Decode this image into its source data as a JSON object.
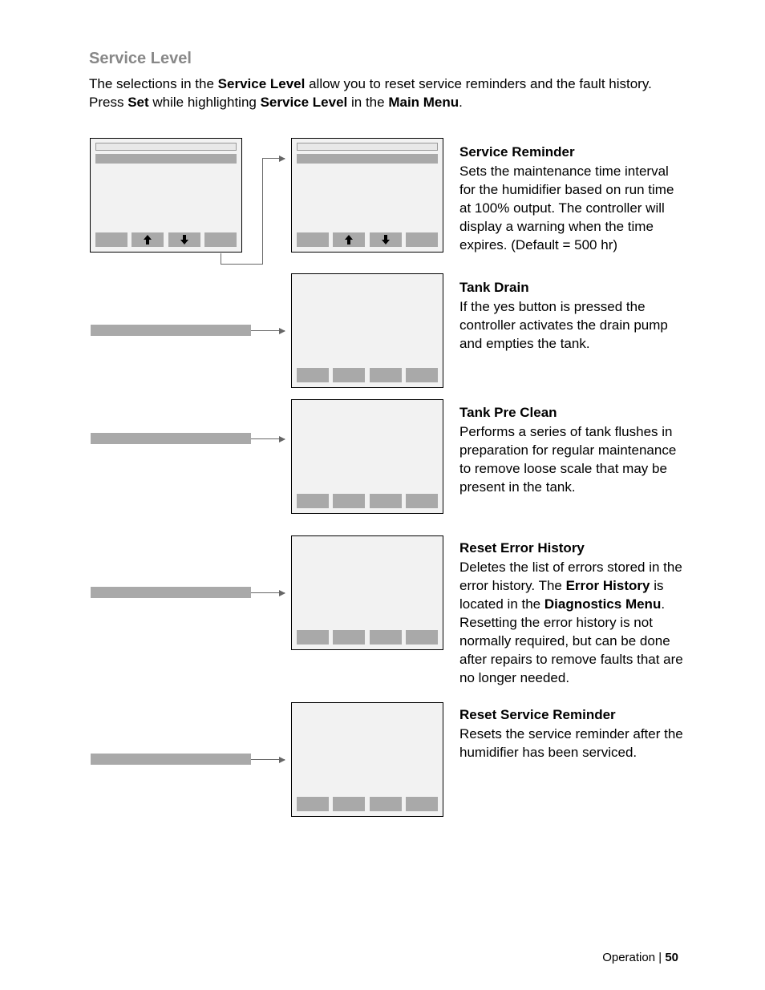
{
  "title": "Service Level",
  "intro": {
    "t1": "The selections in the ",
    "b1": "Service Level",
    "t2": " allow you to reset service reminders and the fault history. Press ",
    "b2": "Set",
    "t3": " while highlighting ",
    "b3": "Service Level",
    "t4": " in the ",
    "b4": "Main Menu",
    "t5": "."
  },
  "items": {
    "service_reminder": {
      "title": "Service Reminder",
      "body": "Sets the maintenance time interval for the humidifier based on run time at 100% output.  The controller will display a warning when the time expires. (Default = 500 hr)"
    },
    "tank_drain": {
      "title": "Tank Drain",
      "body": "If the yes button is pressed the controller activates the drain pump and empties the tank."
    },
    "tank_pre_clean": {
      "title": "Tank Pre Clean",
      "body": "Performs a series of tank flushes in preparation for regular maintenance to remove loose scale that may be present in the tank."
    },
    "reset_error": {
      "title": "Reset Error History",
      "p1": "Deletes the list of errors stored in the error history.  The ",
      "b1": "Error History",
      "p2": " is located in the ",
      "b2": "Diagnostics Menu",
      "p3": ". Resetting the error history is not normally required, but can be done after repairs to remove faults that are no longer needed."
    },
    "reset_service": {
      "title": "Reset Service Reminder",
      "body": "Resets the service reminder after the humidifier has been serviced."
    }
  },
  "footer": {
    "section": "Operation",
    "sep": " | ",
    "page": "50"
  }
}
